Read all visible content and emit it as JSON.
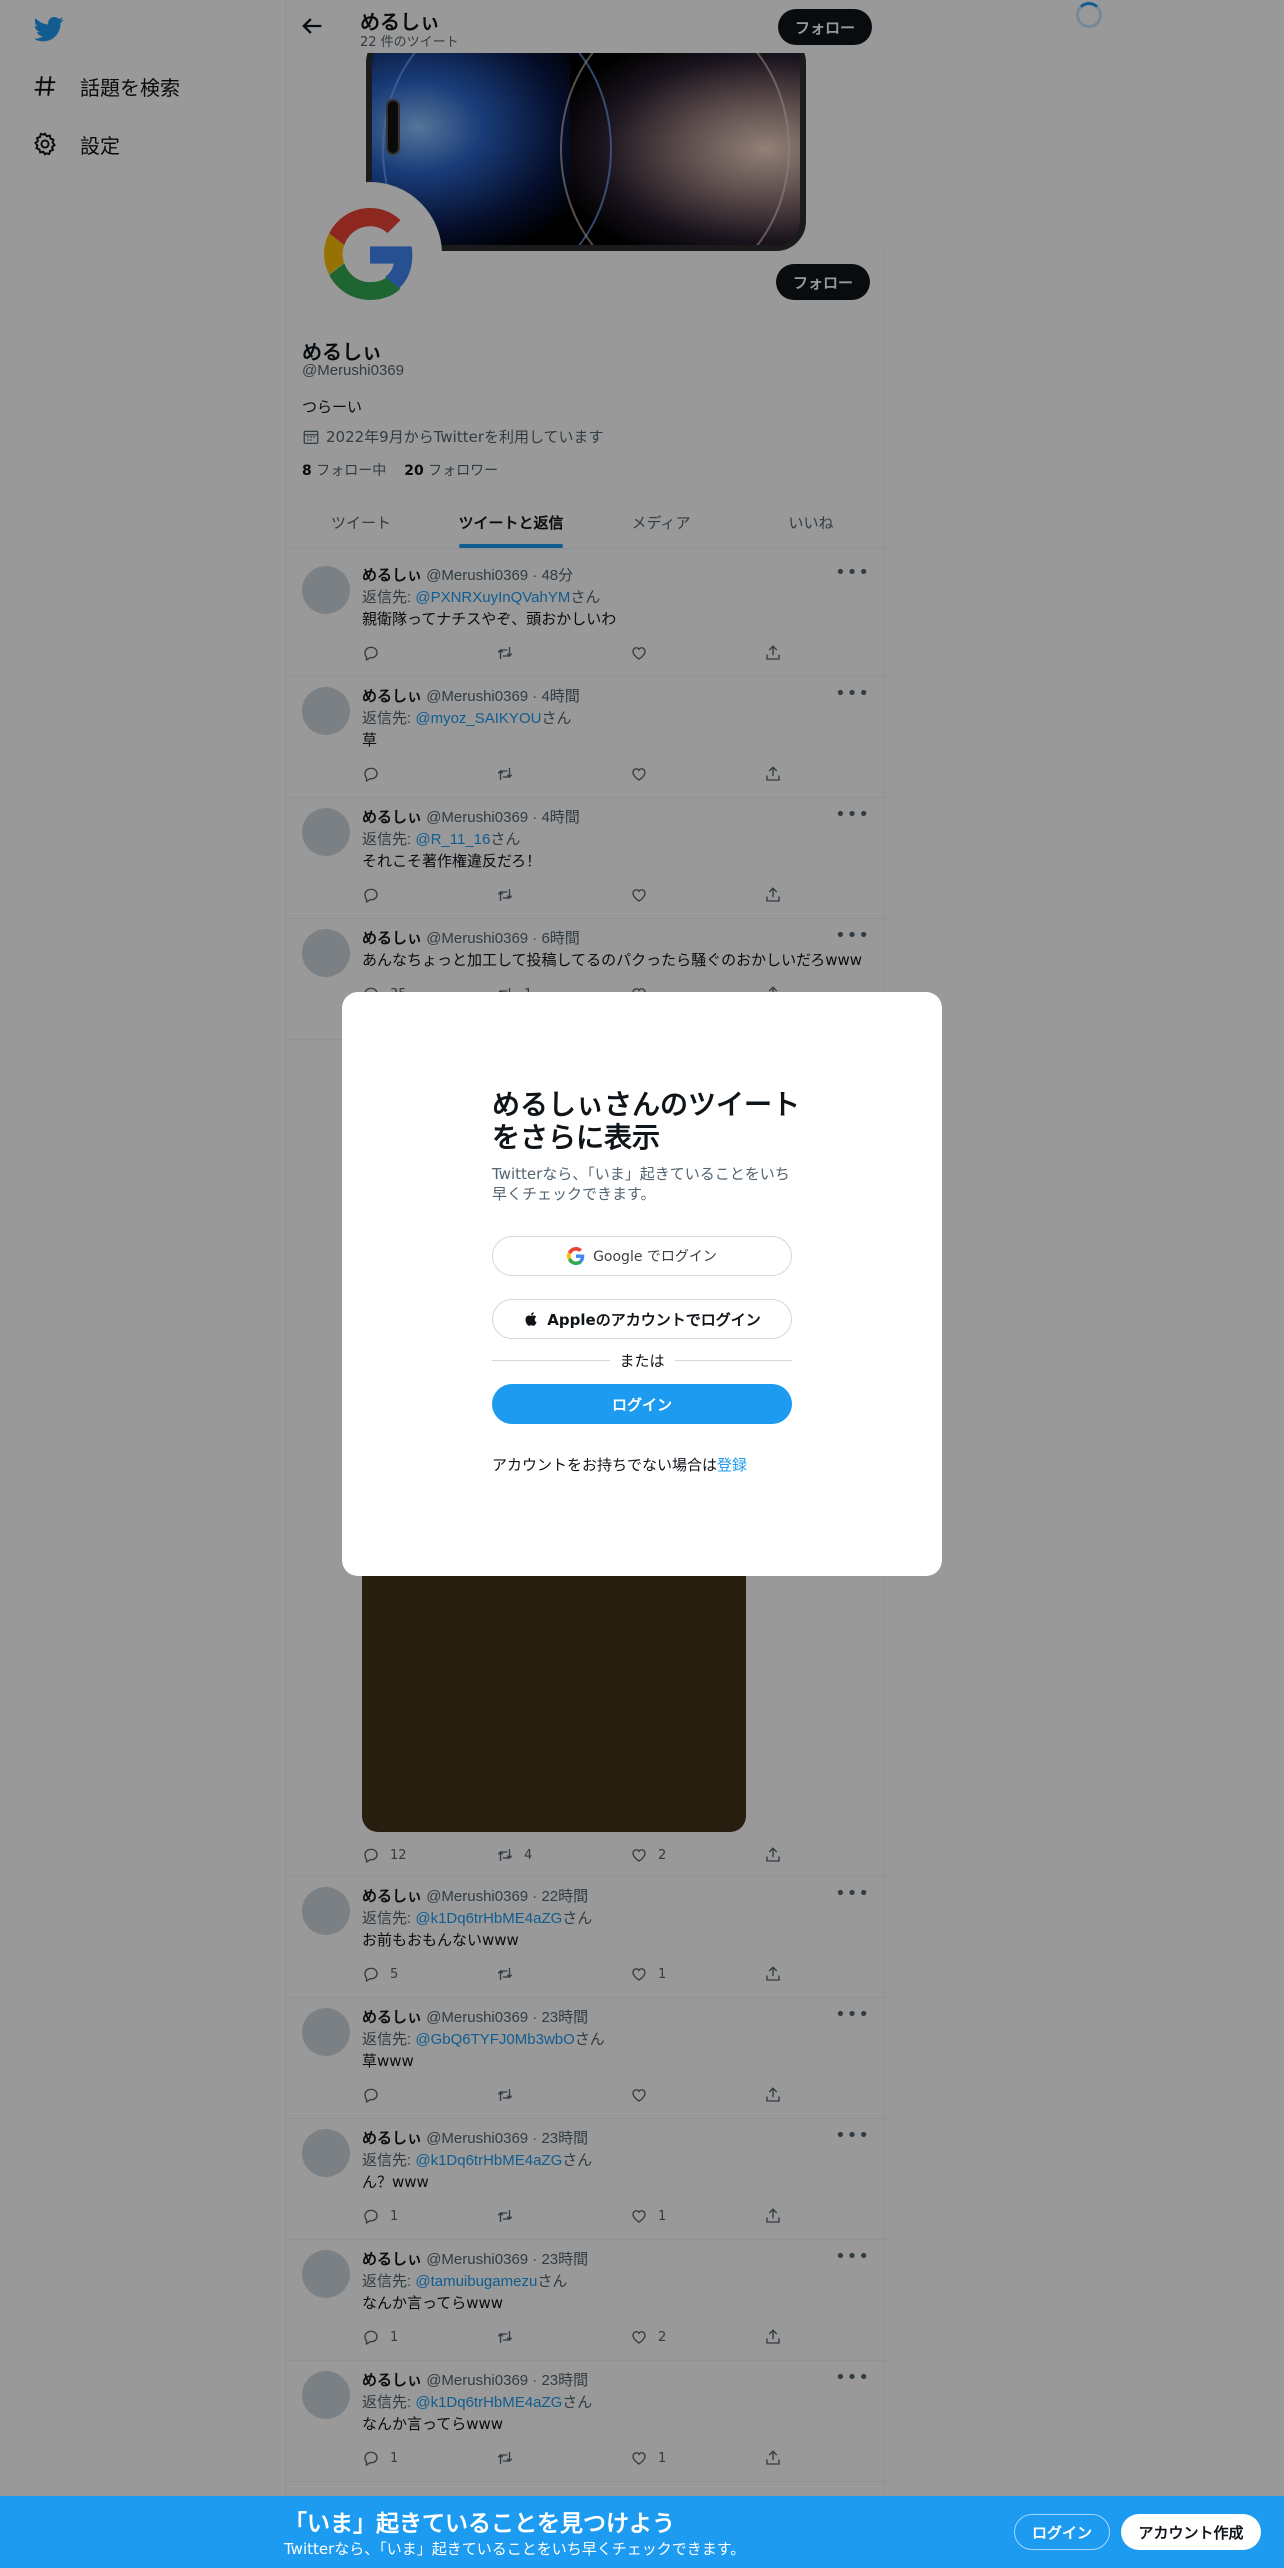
{
  "colors": {
    "accent": "#1d9bf0",
    "text": "#0f1419",
    "secondary": "#536471",
    "media": "#443219"
  },
  "nav": {
    "explore": "話題を検索",
    "settings": "設定"
  },
  "header": {
    "name": "めるしぃ",
    "tweet_count": "22 件のツイート",
    "follow": "フォロー"
  },
  "profile": {
    "name": "めるしぃ",
    "handle": "@Merushi0369",
    "bio": "つらーい",
    "joined": "2022年9月からTwitterを利用しています",
    "following_count": "8",
    "following_label": "フォロー中",
    "followers_count": "20",
    "followers_label": "フォロワー",
    "follow_button": "フォロー"
  },
  "tabs": [
    "ツイート",
    "ツイートと返信",
    "メディア",
    "いいね"
  ],
  "tweets": [
    {
      "name": "めるしぃ",
      "handle": "@Merushi0369 · 48分",
      "reply_prefix": "返信先: ",
      "reply_to": "@PXNRXuyInQVahYM",
      "reply_suffix": "さん",
      "text": "親衛隊ってナチスやぞ、頭おかしいわ",
      "reply": "",
      "retweet": "",
      "like": ""
    },
    {
      "name": "めるしぃ",
      "handle": "@Merushi0369 · 4時間",
      "reply_prefix": "返信先: ",
      "reply_to": "@myoz_SAIKYOU",
      "reply_suffix": "さん",
      "text": "草",
      "reply": "",
      "retweet": "",
      "like": ""
    },
    {
      "name": "めるしぃ",
      "handle": "@Merushi0369 · 4時間",
      "reply_prefix": "返信先: ",
      "reply_to": "@R_11_16",
      "reply_suffix": "さん",
      "text": "それこそ著作権違反だろ！",
      "reply": "",
      "retweet": "",
      "like": ""
    },
    {
      "name": "めるしぃ",
      "handle": "@Merushi0369 · 6時間",
      "text": "あんなちょっと加工して投稿してるのパクったら騒ぐのおかしいだろwww",
      "reply": "35",
      "retweet": "1",
      "like": ""
    },
    {
      "reply": "12",
      "retweet": "4",
      "like": "2"
    },
    {
      "name": "めるしぃ",
      "handle": "@Merushi0369 · 22時間",
      "reply_prefix": "返信先: ",
      "reply_to": "@k1Dq6trHbME4aZG",
      "reply_suffix": "さん",
      "text": "お前もおもんないwww",
      "reply": "5",
      "retweet": "",
      "like": "1"
    },
    {
      "name": "めるしぃ",
      "handle": "@Merushi0369 · 23時間",
      "reply_prefix": "返信先: ",
      "reply_to": "@GbQ6TYFJ0Mb3wbO",
      "reply_suffix": "さん",
      "text": "草www",
      "reply": "",
      "retweet": "",
      "like": ""
    },
    {
      "name": "めるしぃ",
      "handle": "@Merushi0369 · 23時間",
      "reply_prefix": "返信先: ",
      "reply_to": "@k1Dq6trHbME4aZG",
      "reply_suffix": "さん",
      "text": "ん？www",
      "reply": "1",
      "retweet": "",
      "like": "1"
    },
    {
      "name": "めるしぃ",
      "handle": "@Merushi0369 · 23時間",
      "reply_prefix": "返信先: ",
      "reply_to": "@tamuibugamezu",
      "reply_suffix": "さん",
      "text": "なんか言ってらwww",
      "reply": "1",
      "retweet": "",
      "like": "2"
    },
    {
      "name": "めるしぃ",
      "handle": "@Merushi0369 · 23時間",
      "reply_prefix": "返信先: ",
      "reply_to": "@k1Dq6trHbME4aZG",
      "reply_suffix": "さん",
      "text": "なんか言ってらwww",
      "reply": "1",
      "retweet": "",
      "like": "1"
    }
  ],
  "modal": {
    "title": "めるしぃさんのツイートをさらに表示",
    "subtitle": "Twitterなら、「いま」起きていることをいち早くチェックできます。",
    "google_button": "Google でログイン",
    "apple_button": "Appleのアカウントでログイン",
    "or": "または",
    "login": "ログイン",
    "footer_text": "アカウントをお持ちでない場合は",
    "footer_link": "登録"
  },
  "bottom": {
    "title": "「いま」起きていることを見つけよう",
    "subtitle": "Twitterなら、「いま」起きていることをいち早くチェックできます。",
    "login": "ログイン",
    "signup": "アカウント作成"
  }
}
